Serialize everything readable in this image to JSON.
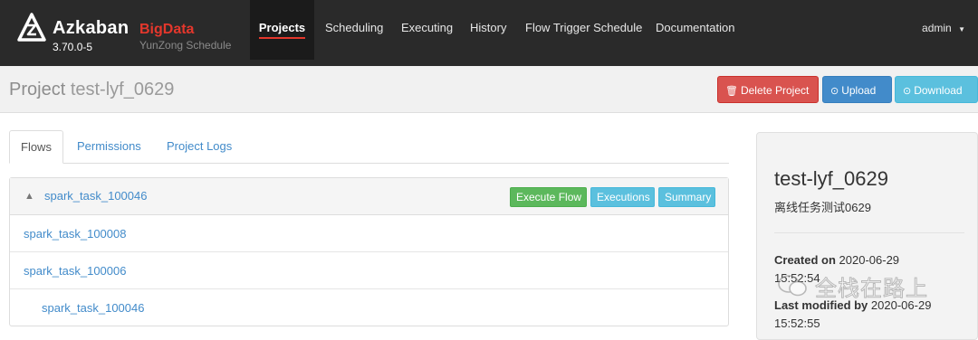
{
  "brand": {
    "name": "Azkaban",
    "tag": "BigData",
    "version": "3.70.0-5",
    "subtitle": "YunZong Schedule",
    "logo_icon": "azkaban-logo-icon"
  },
  "nav": {
    "items": [
      {
        "label": "Projects",
        "active": true
      },
      {
        "label": "Scheduling"
      },
      {
        "label": "Executing"
      },
      {
        "label": "History"
      },
      {
        "label": "Flow Trigger Schedule"
      },
      {
        "label": "Documentation"
      }
    ],
    "user": "admin",
    "user_caret_icon": "caret-down-icon"
  },
  "header": {
    "title_prefix": "Project",
    "project_name": "test-lyf_0629",
    "delete_label": "Delete Project",
    "upload_label": "Upload",
    "download_label": "Download"
  },
  "tabs": [
    {
      "label": "Flows",
      "active": true
    },
    {
      "label": "Permissions"
    },
    {
      "label": "Project Logs"
    }
  ],
  "flow": {
    "name": "spark_task_100046",
    "execute_label": "Execute Flow",
    "executions_label": "Executions",
    "summary_label": "Summary",
    "jobs": [
      {
        "name": "spark_task_100008"
      },
      {
        "name": "spark_task_100006"
      },
      {
        "name": "spark_task_100046"
      }
    ]
  },
  "sidebar": {
    "name": "test-lyf_0629",
    "description": "离线任务测试0629",
    "created_label": "Created on",
    "created_value": "2020-06-29",
    "created_time": "15:52:54",
    "modified_label": "Last modified by",
    "modified_value": "2020-06-29",
    "modified_time": "15:52:55"
  },
  "watermark": {
    "text": "全栈在路上"
  },
  "colors": {
    "navbar": "#2a2a2a",
    "accent_red": "#e4372c",
    "danger": "#d9534f",
    "primary": "#428bca",
    "info": "#5bc0de",
    "success": "#5cb85c"
  }
}
